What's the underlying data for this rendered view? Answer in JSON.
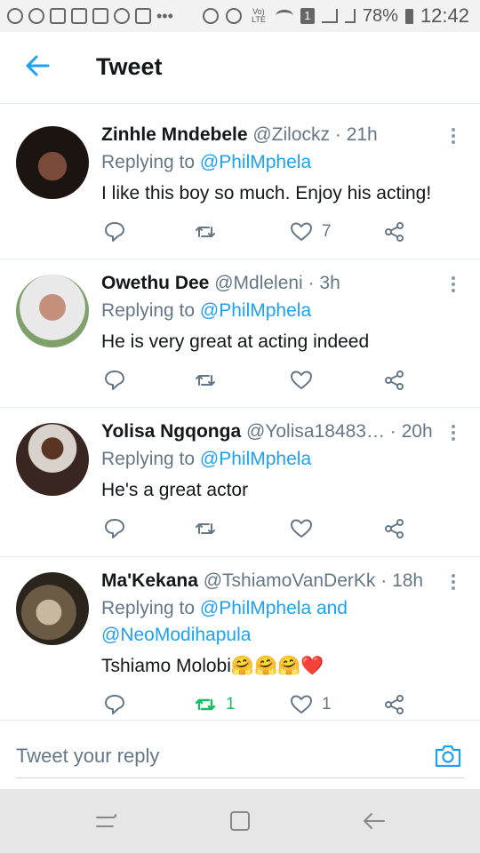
{
  "status_bar": {
    "battery": "78%",
    "time": "12:42",
    "sim": "1",
    "volte": "Vo) LTE"
  },
  "header": {
    "title": "Tweet"
  },
  "tweets": [
    {
      "name": "Zinhle  Mndebele",
      "handle": "@Zilockz",
      "time": "21h",
      "reply_prefix": "Replying to ",
      "reply_to": "@PhilMphela",
      "reply_to_2": "",
      "text": "I like this boy so much. Enjoy his acting!",
      "likes": "7",
      "retweets": ""
    },
    {
      "name": "Owethu Dee",
      "handle": "@Mdleleni",
      "time": "3h",
      "reply_prefix": "Replying to ",
      "reply_to": "@PhilMphela",
      "reply_to_2": "",
      "text": "He is very great at acting indeed",
      "likes": "",
      "retweets": ""
    },
    {
      "name": "Yolisa Ngqonga",
      "handle": "@Yolisa18483…",
      "time": "20h",
      "reply_prefix": "Replying to ",
      "reply_to": "@PhilMphela",
      "reply_to_2": "",
      "text": "He's a great actor",
      "likes": "",
      "retweets": ""
    },
    {
      "name": "Ma'Kekana",
      "handle": "@TshiamoVanDerKk",
      "time": "18h",
      "reply_prefix": "Replying to ",
      "reply_to": "@PhilMphela and",
      "reply_to_2": "@NeoModihapula",
      "text": "Tshiamo Molobi🤗🤗🤗❤️",
      "likes": "1",
      "retweets": "1"
    }
  ],
  "composer": {
    "placeholder": "Tweet your reply"
  },
  "colors": {
    "accent": "#1da1f2",
    "retweet_active": "#17bf63",
    "secondary_text": "#657786"
  },
  "icons": [
    "back-arrow-icon",
    "more-icon",
    "reply-icon",
    "retweet-icon",
    "like-icon",
    "share-icon",
    "camera-icon",
    "recents-icon",
    "home-icon",
    "back-nav-icon"
  ]
}
